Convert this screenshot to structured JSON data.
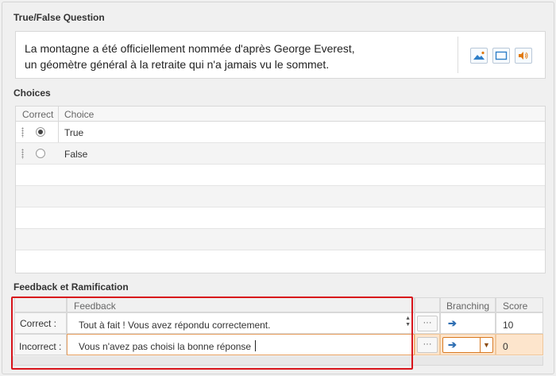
{
  "question": {
    "title": "True/False Question",
    "text": "La montagne a été officiellement nommée d'après George Everest,\nun géomètre général à la retraite qui n'a jamais vu le sommet.",
    "media_buttons": [
      {
        "icon": "image-icon",
        "color": "#2f7fc8"
      },
      {
        "icon": "video-icon",
        "color": "#2f7fc8"
      },
      {
        "icon": "audio-icon",
        "color": "#e07a10"
      }
    ]
  },
  "choices": {
    "title": "Choices",
    "columns": [
      "Correct",
      "Choice"
    ],
    "rows": [
      {
        "label": "True",
        "correct": true
      },
      {
        "label": "False",
        "correct": false
      }
    ],
    "empty_row_count": 5
  },
  "feedback": {
    "title": "Feedback et Ramification",
    "columns": {
      "feedback": "Feedback",
      "branching": "Branching",
      "score": "Score"
    },
    "rows": [
      {
        "label": "Correct :",
        "text": "Tout à fait ! Vous avez répondu correctement.",
        "more": "···",
        "branch_icon": "arrow-right-icon",
        "score": "10"
      },
      {
        "label": "Incorrect :",
        "text": "Vous n'avez pas choisi la bonne réponse",
        "more": "···",
        "branch_icon": "arrow-right-icon",
        "score": "0"
      }
    ]
  },
  "colors": {
    "highlight_border": "#d8141b",
    "selected_row": "#fde5cc",
    "accent": "#2f6fb3"
  }
}
